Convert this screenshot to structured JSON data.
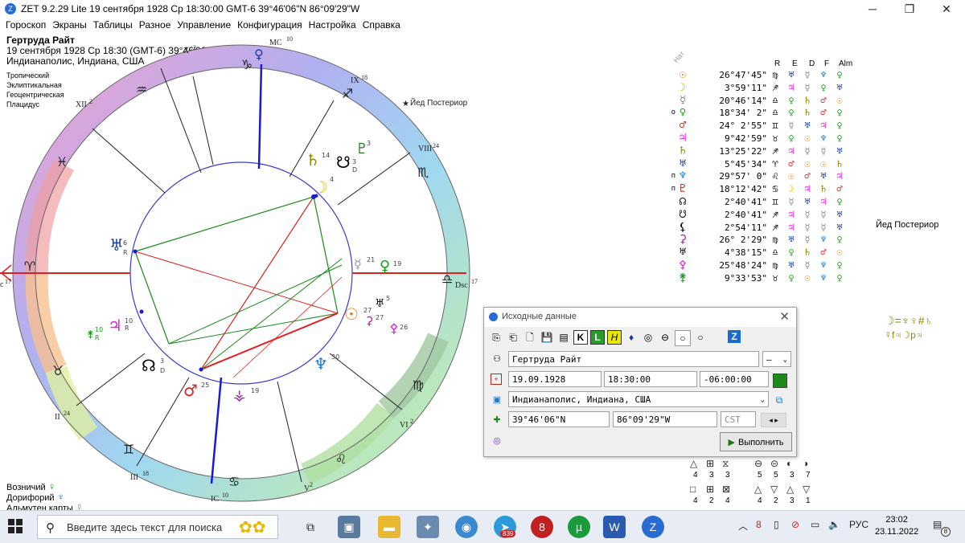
{
  "window": {
    "app_icon": "zet-app-icon",
    "title": "ZET 9.2.29 Lite   19 сентября 1928  Ср  18:30:00 GMT-6 39°46'06\"N  86°09'29\"W",
    "minimize": "─",
    "maximize": "❐",
    "close": "✕"
  },
  "menu": [
    "Гороскоп",
    "Экраны",
    "Таблицы",
    "Разное",
    "Управление",
    "Конфигурация",
    "Настройка",
    "Справка"
  ],
  "person": {
    "name": "Гертруда Райт",
    "datetime": "19 сентября 1928  Ср  18:30 (GMT-6) 39°46'06\"N  86°09'29\"W",
    "place": "Индианаполис, Индиана, США"
  },
  "settings": [
    "Тропический",
    "Эклиптикальная",
    "Геоцентрическая",
    "Плацидус"
  ],
  "chart": {
    "houses": {
      "mc": "MC",
      "mc_deg": "10",
      "ix": "IX",
      "ix_deg": "18",
      "viii": "VIII",
      "viii_deg": "24",
      "dsc": "Dsc",
      "dsc_deg": "17",
      "vi": "VI",
      "vi_deg": "2",
      "v": "V",
      "v_deg": "2",
      "ic": "IC",
      "ic_deg": "10",
      "iii": "III",
      "iii_deg": "18",
      "ii": "II",
      "ii_deg": "24",
      "asc": "c",
      "asc_deg": "17",
      "xii": "XII",
      "xii_deg": "2",
      "xi": "X",
      "xi_deg": "2"
    },
    "signs": [
      "♑",
      "♒",
      "♓",
      "♈",
      "♉",
      "♊",
      "♋",
      "♌",
      "♍",
      "♎",
      "♏",
      "♐"
    ],
    "fixed_star": "Йед Постериор",
    "planets": [
      {
        "glyph": "♄",
        "deg": "14",
        "color": "#8a8a00"
      },
      {
        "glyph": "☋",
        "deg": "3",
        "sub": "D",
        "color": "#000"
      },
      {
        "glyph": "♇",
        "deg": "3",
        "color": "#2a7a2a"
      },
      {
        "glyph": "☽",
        "deg": "4",
        "color": "#8a8a00"
      },
      {
        "glyph": "♅",
        "deg": "6",
        "sub": "R",
        "color": "#1a3aa0"
      },
      {
        "glyph": "☿",
        "deg": "21",
        "color": "#888"
      },
      {
        "glyph": "♀",
        "deg": "19",
        "color": "#1a9a1a"
      },
      {
        "glyph": "♅",
        "deg": "5",
        "color": "#000"
      },
      {
        "glyph": "☉",
        "deg": "27",
        "color": "#f07a00"
      },
      {
        "glyph": "⚳",
        "deg": "27",
        "color": "#a020a0"
      },
      {
        "glyph": "⚴",
        "deg": "26",
        "color": "#e020e0"
      },
      {
        "glyph": "♃",
        "deg": "10",
        "sub": "R",
        "color": "#e020e0"
      },
      {
        "glyph": "⚵",
        "deg": "10",
        "sub": "R",
        "color": "#1a9a1a"
      },
      {
        "glyph": "♆",
        "deg": "30",
        "color": "#1a7ad0"
      },
      {
        "glyph": "☊",
        "deg": "3",
        "sub": "D",
        "color": "#000"
      },
      {
        "glyph": "♂",
        "deg": "25",
        "color": "#e02020"
      },
      {
        "glyph": "⚶",
        "deg": "19",
        "color": "#a020a0"
      }
    ]
  },
  "table": {
    "nat_label": "Нат",
    "headers": [
      "R",
      "E",
      "D",
      "F",
      "Alm"
    ],
    "rows": [
      {
        "mark": "",
        "glyph": "☉",
        "gcolor": "#f07a00",
        "pos": "26°47'45\"",
        "sign": "♍",
        "r": "♅",
        "e": "☿",
        "d": "♆",
        "f": "♀"
      },
      {
        "mark": "",
        "glyph": "☽",
        "gcolor": "#c8c800",
        "pos": "3°59'11\"",
        "sign": "♐",
        "r": "♃",
        "e": "☿",
        "d": "♀",
        "f": "♅"
      },
      {
        "mark": "",
        "glyph": "☿",
        "gcolor": "#888",
        "pos": "20°46'14\"",
        "sign": "♎",
        "r": "♀",
        "e": "♄",
        "d": "♂",
        "f": "☉"
      },
      {
        "mark": "о",
        "glyph": "♀",
        "gcolor": "#1a9a1a",
        "pos": "18°34' 2\"",
        "sign": "♎",
        "r": "♀",
        "e": "♄",
        "d": "♂",
        "f": "♀"
      },
      {
        "mark": "",
        "glyph": "♂",
        "gcolor": "#e02020",
        "pos": "24° 2'55\"",
        "sign": "♊",
        "r": "☿",
        "e": "♅",
        "d": "♃",
        "f": "♀"
      },
      {
        "mark": "",
        "glyph": "♃",
        "gcolor": "#e020e0",
        "pos": "9°42'59\"",
        "sign": "♉",
        "r": "♀",
        "e": "☉",
        "d": "♆",
        "f": "♀"
      },
      {
        "mark": "",
        "glyph": "♄",
        "gcolor": "#8a8a00",
        "pos": "13°25'22\"",
        "sign": "♐",
        "r": "♃",
        "e": "☿",
        "d": "☿",
        "f": "♅"
      },
      {
        "mark": "",
        "glyph": "♅",
        "gcolor": "#1a3aa0",
        "pos": "5°45'34\"",
        "sign": "♈",
        "r": "♂",
        "e": "☉",
        "d": "☉",
        "f": "♄"
      },
      {
        "mark": "п",
        "glyph": "♆",
        "gcolor": "#1a7ad0",
        "pos": "29°57' 0\"",
        "sign": "♌",
        "r": "☉",
        "e": "♂",
        "d": "♅",
        "f": "♃"
      },
      {
        "mark": "п",
        "glyph": "♇",
        "gcolor": "#a02020",
        "pos": "18°12'42\"",
        "sign": "♋",
        "r": "☽",
        "e": "♃",
        "d": "♄",
        "f": "♂"
      },
      {
        "mark": "",
        "glyph": "☊",
        "gcolor": "#000",
        "pos": "2°40'41\"",
        "sign": "♊",
        "r": "☿",
        "e": "♅",
        "d": "♃",
        "f": "♀"
      },
      {
        "mark": "",
        "glyph": "☋",
        "gcolor": "#000",
        "pos": "2°40'41\"",
        "sign": "♐",
        "r": "♃",
        "e": "☿",
        "d": "☿",
        "f": "♅"
      },
      {
        "mark": "",
        "glyph": "⚸",
        "gcolor": "#000",
        "pos": "2°54'11\"",
        "sign": "♐",
        "r": "♃",
        "e": "☿",
        "d": "☿",
        "f": "♅"
      },
      {
        "mark": "",
        "glyph": "⚳",
        "gcolor": "#a020a0",
        "pos": "26° 2'29\"",
        "sign": "♍",
        "r": "♅",
        "e": "☿",
        "d": "♆",
        "f": "♀"
      },
      {
        "mark": "",
        "glyph": "♅",
        "gcolor": "#000",
        "pos": "4°38'15\"",
        "sign": "♎",
        "r": "♀",
        "e": "♄",
        "d": "♂",
        "f": "☉"
      },
      {
        "mark": "",
        "glyph": "⚴",
        "gcolor": "#e020e0",
        "pos": "25°48'24\"",
        "sign": "♍",
        "r": "♅",
        "e": "☿",
        "d": "♆",
        "f": "♀"
      },
      {
        "mark": "",
        "glyph": "⚵",
        "gcolor": "#1a9a1a",
        "pos": "9°33'53\"",
        "sign": "♉",
        "r": "♀",
        "e": "☉",
        "d": "♆",
        "f": "♀"
      }
    ]
  },
  "side_star": "Йед Постериор",
  "aspects_right": {
    "line1": "☽=♆♀#♄",
    "line2": "☿f♃☽p♃"
  },
  "dialog": {
    "title": "Исходные данные",
    "close": "✕",
    "toolbar": [
      "⎘",
      "⎗",
      "🗋",
      "💾",
      "▤",
      "K",
      "L",
      "H",
      "♦",
      "◎",
      "⊖",
      "○",
      "○",
      "Z"
    ],
    "name": "Гертруда Райт",
    "gender": "–",
    "date": "19.09.1928",
    "time": "18:30:00",
    "tz": "-06:00:00",
    "place": "Индианаполис, Индиана, США",
    "lat": "39°46'06\"N",
    "lon": "86°09'29\"W",
    "tz_name": "CST",
    "run": "Выполнить"
  },
  "bottom_left": [
    "Возничий",
    "Дорифорий",
    "Альмутен карты"
  ],
  "legend": {
    "top_counts": [
      "4",
      "3",
      "3",
      "5",
      "5",
      "3",
      "7"
    ],
    "bottom_counts": [
      "4",
      "2",
      "4",
      "4",
      "2",
      "3",
      "1"
    ]
  },
  "taskbar": {
    "search_placeholder": "Введите здесь текст для поиска",
    "lang": "РУС",
    "time": "23:02",
    "date": "23.11.2022",
    "badge": "839",
    "notifications": "8"
  }
}
